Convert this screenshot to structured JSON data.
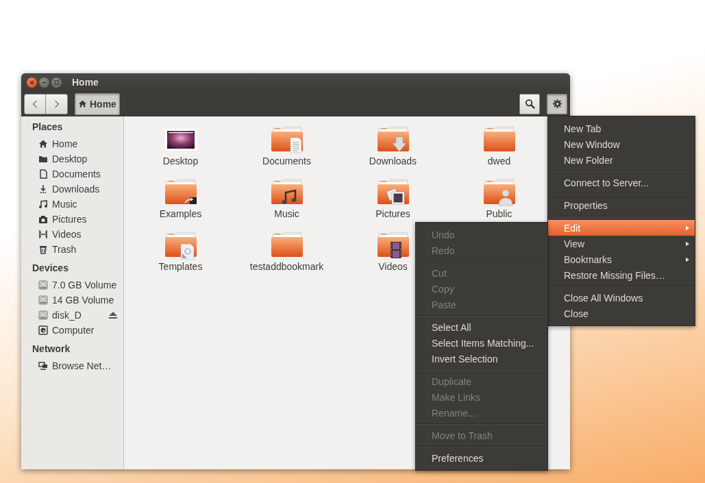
{
  "window": {
    "title": "Home"
  },
  "toolbar": {
    "path": [
      {
        "label": "Home",
        "selected": true
      }
    ],
    "search": {
      "pressed": false
    },
    "settings": {
      "pressed": true
    }
  },
  "sidebar": {
    "sections": [
      {
        "title": "Places",
        "items": [
          {
            "label": "Home",
            "kind": "home",
            "eject": false
          },
          {
            "label": "Desktop",
            "kind": "desktop",
            "eject": false
          },
          {
            "label": "Documents",
            "kind": "documents",
            "eject": false
          },
          {
            "label": "Downloads",
            "kind": "downloads",
            "eject": false
          },
          {
            "label": "Music",
            "kind": "music",
            "eject": false
          },
          {
            "label": "Pictures",
            "kind": "pictures",
            "eject": false
          },
          {
            "label": "Videos",
            "kind": "videos",
            "eject": false
          },
          {
            "label": "Trash",
            "kind": "trash",
            "eject": false
          }
        ]
      },
      {
        "title": "Devices",
        "items": [
          {
            "label": "7.0 GB Volume",
            "kind": "drive",
            "eject": false
          },
          {
            "label": "14 GB Volume",
            "kind": "drive",
            "eject": false
          },
          {
            "label": "disk_D",
            "kind": "drive",
            "eject": true
          },
          {
            "label": "Computer",
            "kind": "computer",
            "eject": false
          }
        ]
      },
      {
        "title": "Network",
        "items": [
          {
            "label": "Browse Net…",
            "kind": "network",
            "eject": false
          }
        ]
      }
    ]
  },
  "files": [
    {
      "name": "Desktop",
      "kind": "desktop"
    },
    {
      "name": "Documents",
      "kind": "documents"
    },
    {
      "name": "Downloads",
      "kind": "downloads"
    },
    {
      "name": "dwed",
      "kind": "folder"
    },
    {
      "name": "Examples",
      "kind": "examples"
    },
    {
      "name": "Music",
      "kind": "music"
    },
    {
      "name": "Pictures",
      "kind": "pictures"
    },
    {
      "name": "Public",
      "kind": "public"
    },
    {
      "name": "Templates",
      "kind": "templates"
    },
    {
      "name": "testaddbookmark",
      "kind": "folder"
    },
    {
      "name": "Videos",
      "kind": "videos"
    }
  ],
  "gear_menu": {
    "groups": [
      {
        "items": [
          {
            "label": "New Tab",
            "selected": false,
            "submenu": false
          },
          {
            "label": "New Window",
            "selected": false,
            "submenu": false
          },
          {
            "label": "New Folder",
            "selected": false,
            "submenu": false
          }
        ]
      },
      {
        "items": [
          {
            "label": "Connect to Server...",
            "selected": false,
            "submenu": false
          }
        ]
      },
      {
        "items": [
          {
            "label": "Properties",
            "selected": false,
            "submenu": false
          }
        ]
      },
      {
        "items": [
          {
            "label": "Edit",
            "selected": true,
            "submenu": true
          },
          {
            "label": "View",
            "selected": false,
            "submenu": true
          },
          {
            "label": "Bookmarks",
            "selected": false,
            "submenu": true
          },
          {
            "label": "Restore Missing Files…",
            "selected": false,
            "submenu": false
          }
        ]
      },
      {
        "items": [
          {
            "label": "Close All Windows",
            "selected": false,
            "submenu": false
          },
          {
            "label": "Close",
            "selected": false,
            "submenu": false
          }
        ]
      }
    ]
  },
  "edit_menu": {
    "groups": [
      {
        "items": [
          {
            "label": "Undo",
            "disabled": true
          },
          {
            "label": "Redo",
            "disabled": true
          }
        ]
      },
      {
        "items": [
          {
            "label": "Cut",
            "disabled": true
          },
          {
            "label": "Copy",
            "disabled": true
          },
          {
            "label": "Paste",
            "disabled": true
          }
        ]
      },
      {
        "items": [
          {
            "label": "Select All",
            "disabled": false
          },
          {
            "label": "Select Items Matching...",
            "disabled": false
          },
          {
            "label": "Invert Selection",
            "disabled": false
          }
        ]
      },
      {
        "items": [
          {
            "label": "Duplicate",
            "disabled": true
          },
          {
            "label": "Make Links",
            "disabled": true
          },
          {
            "label": "Rename...",
            "disabled": true
          }
        ]
      },
      {
        "items": [
          {
            "label": "Move to Trash",
            "disabled": true
          }
        ]
      },
      {
        "items": [
          {
            "label": "Preferences",
            "disabled": false
          }
        ]
      }
    ]
  }
}
